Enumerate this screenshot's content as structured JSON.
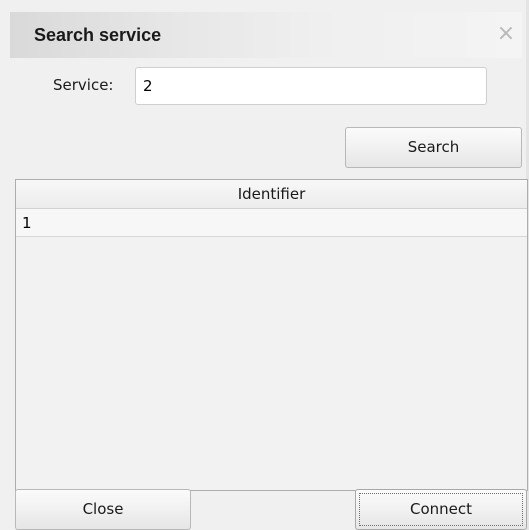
{
  "dialog": {
    "title": "Search service",
    "close_icon": "×"
  },
  "form": {
    "service_label": "Service:",
    "service_value": "2"
  },
  "toolbar": {
    "search_label": "Search"
  },
  "table": {
    "columns": [
      "Identifier"
    ],
    "rows": [
      [
        "1"
      ]
    ]
  },
  "footer": {
    "close_label": "Close",
    "connect_label": "Connect"
  }
}
